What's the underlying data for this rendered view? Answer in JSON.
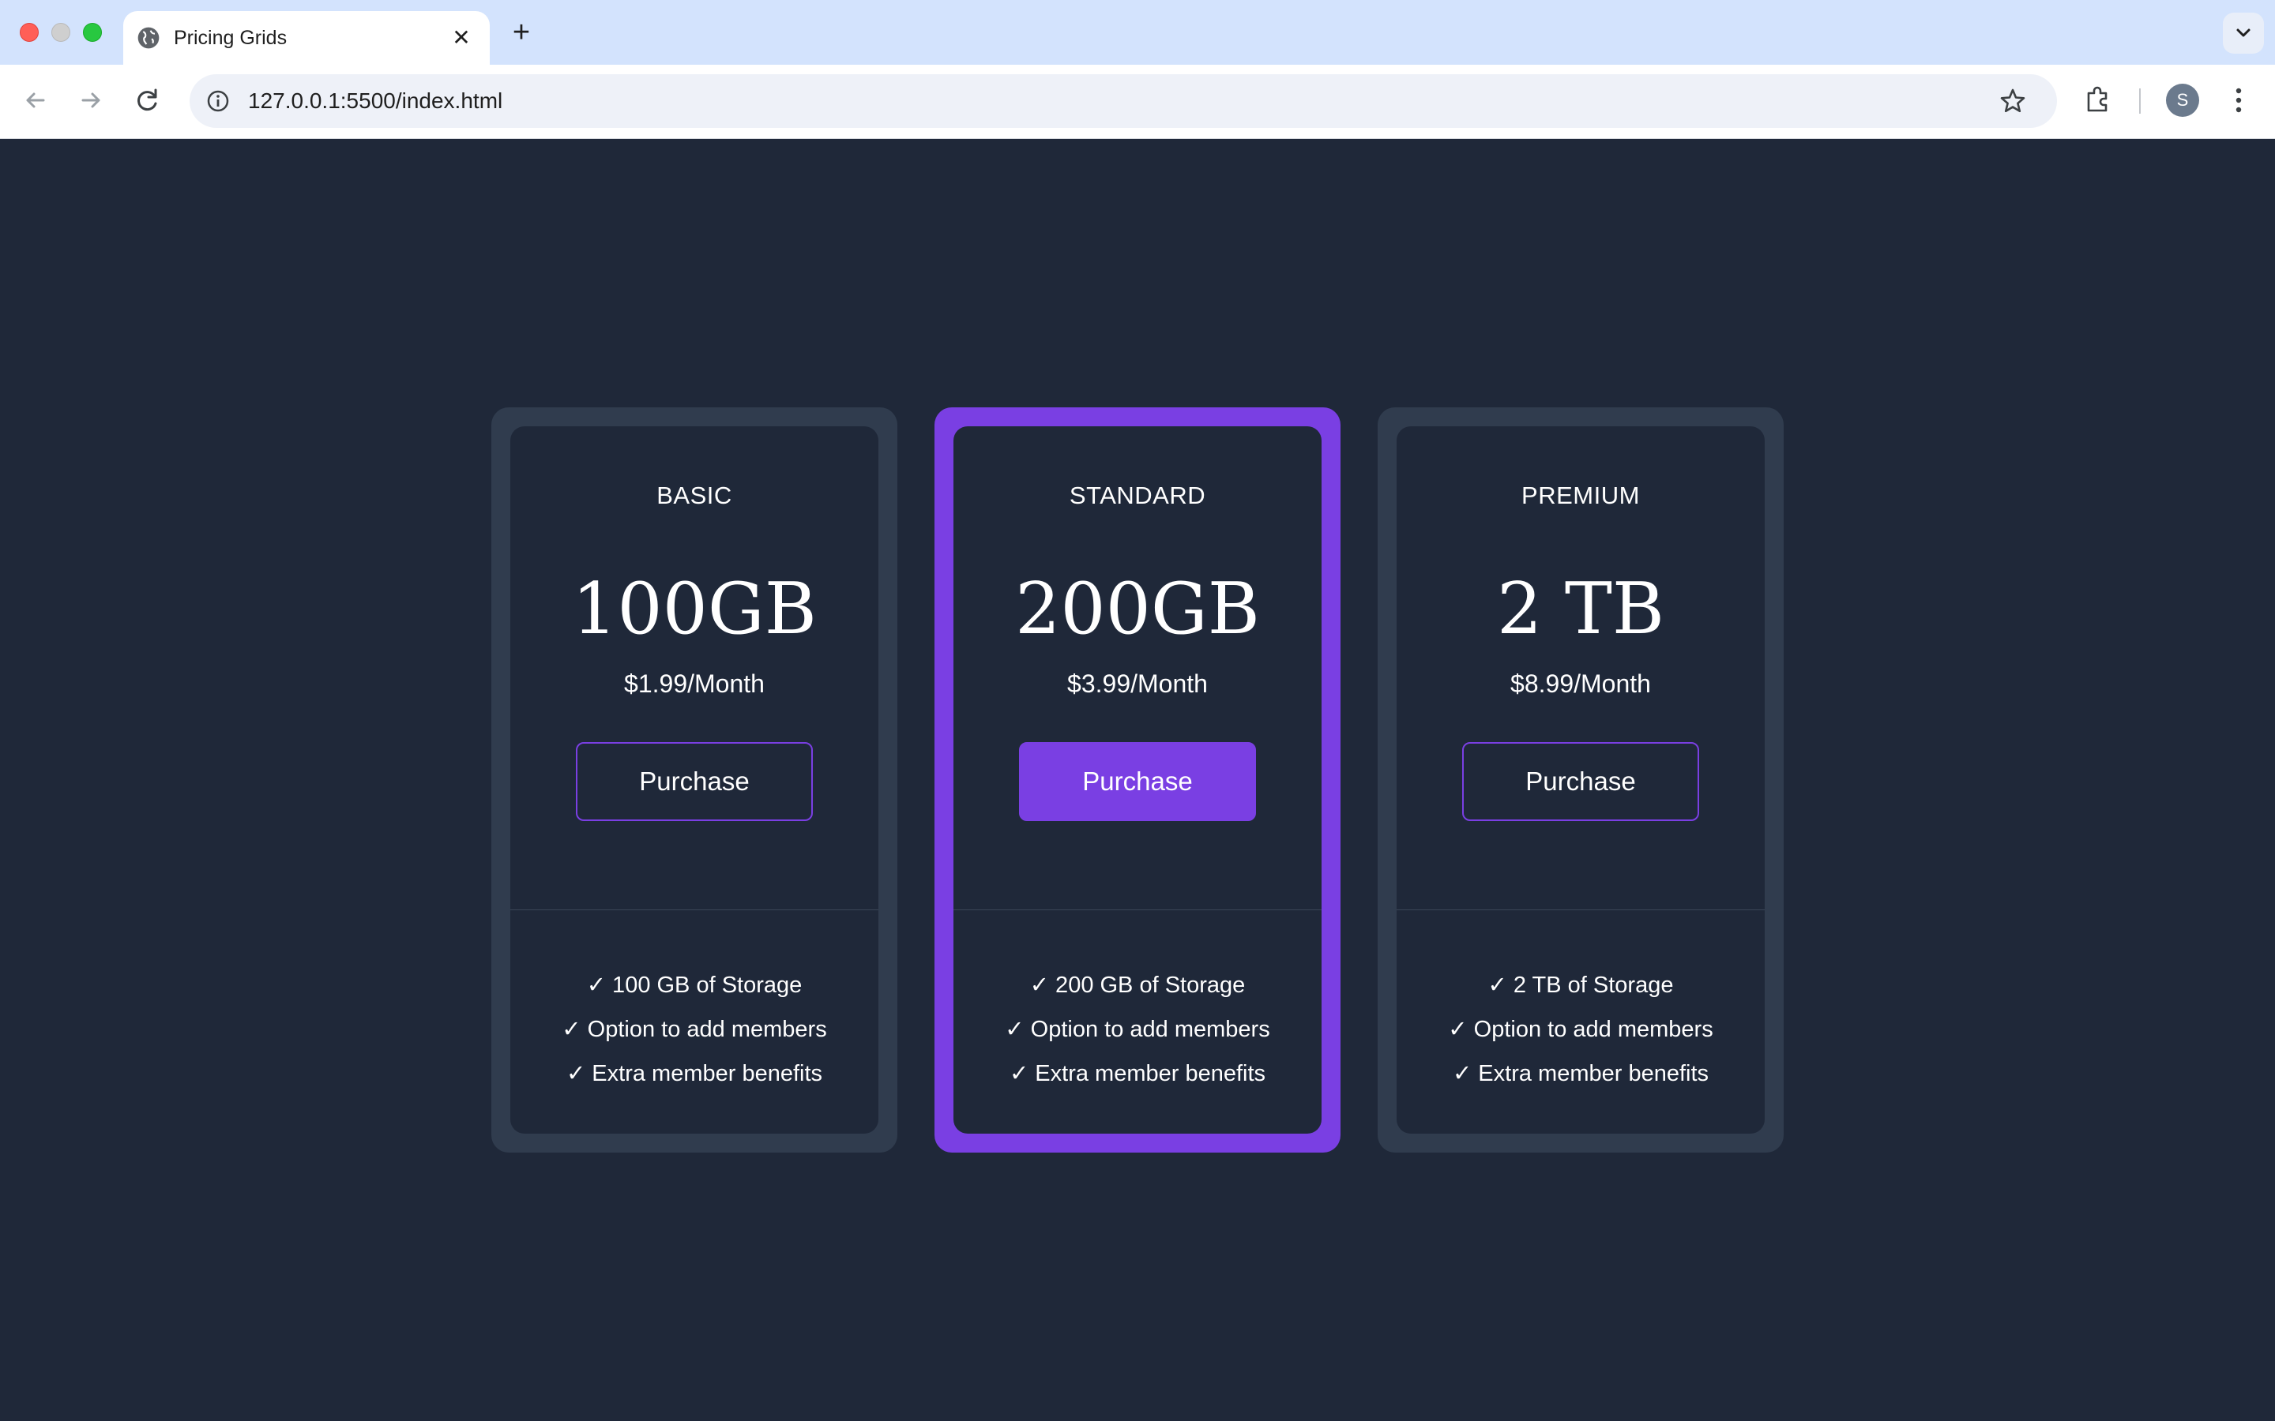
{
  "browser": {
    "tab_title": "Pricing Grids",
    "tab_close": "✕",
    "new_tab": "+",
    "url": "127.0.0.1:5500/index.html",
    "profile_initial": "S"
  },
  "colors": {
    "background": "#1f2839",
    "card": "#303c4e",
    "accent": "#7a3fe3"
  },
  "plans": [
    {
      "name": "BASIC",
      "size": "100GB",
      "price": "$1.99/Month",
      "button": "Purchase",
      "features": [
        "✓ 100 GB of Storage",
        "✓ Option to add members",
        "✓ Extra member benefits"
      ]
    },
    {
      "name": "STANDARD",
      "size": "200GB",
      "price": "$3.99/Month",
      "button": "Purchase",
      "features": [
        "✓ 200 GB of Storage",
        "✓ Option to add members",
        "✓ Extra member benefits"
      ]
    },
    {
      "name": "PREMIUM",
      "size": "2 TB",
      "price": "$8.99/Month",
      "button": "Purchase",
      "features": [
        "✓ 2 TB of Storage",
        "✓ Option to add members",
        "✓ Extra member benefits"
      ]
    }
  ]
}
